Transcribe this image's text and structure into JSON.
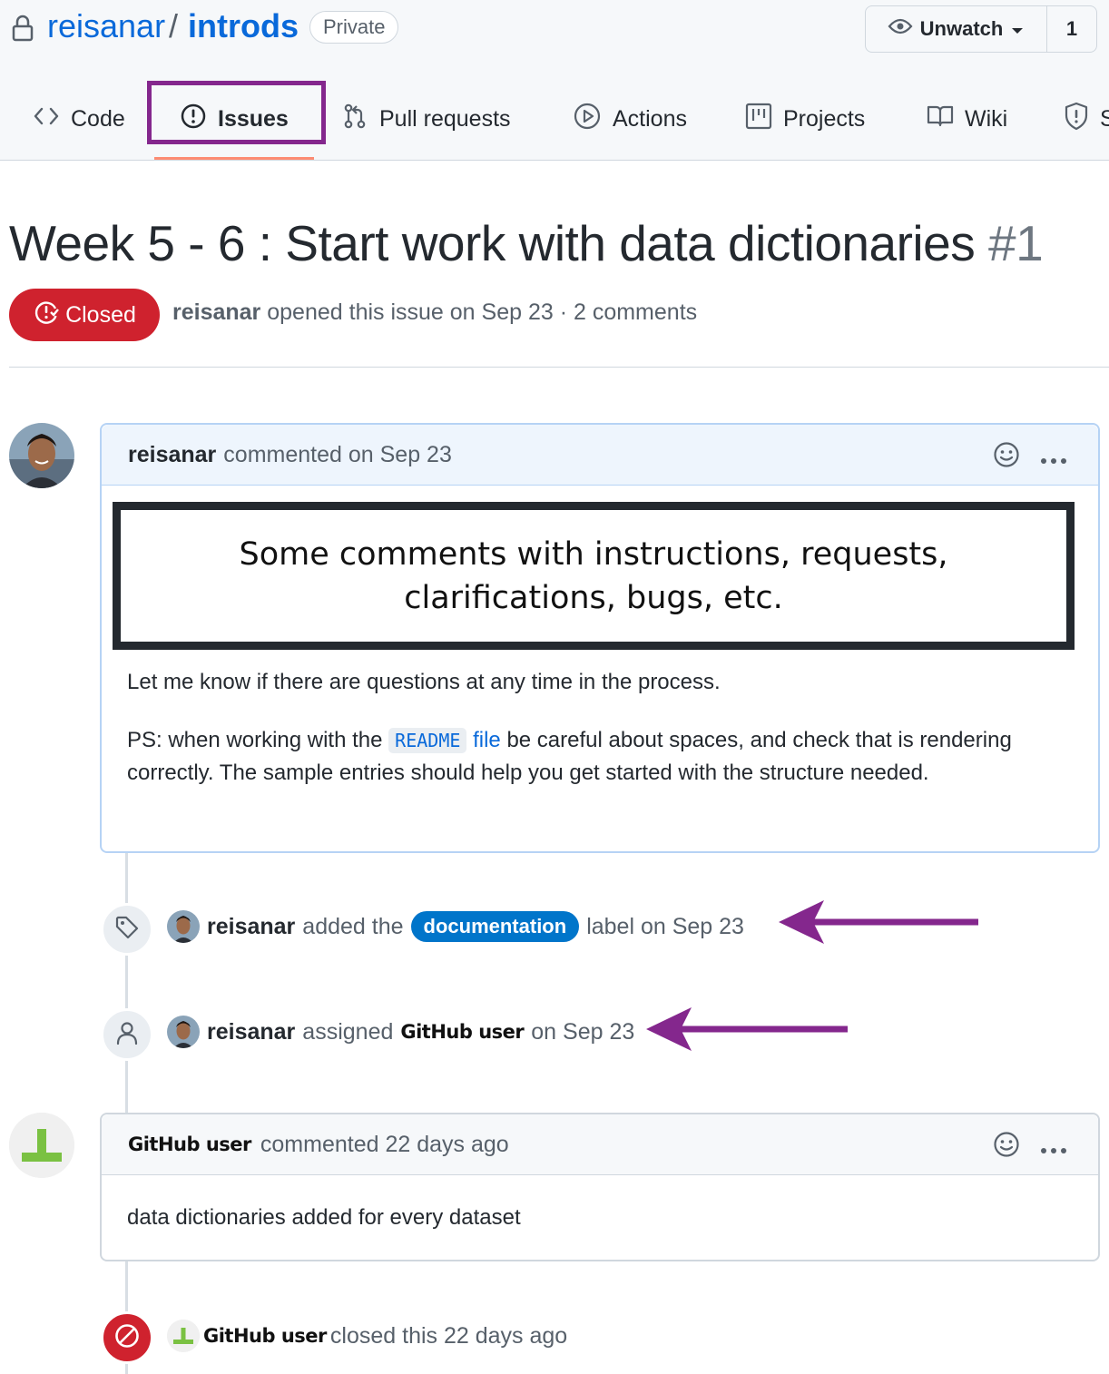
{
  "repo": {
    "owner": "reisanar",
    "separator": "/",
    "name": "introds",
    "visibility": "Private"
  },
  "watch": {
    "label": "Unwatch",
    "count": "1"
  },
  "tabs": [
    {
      "label": "Code"
    },
    {
      "label": "Issues"
    },
    {
      "label": "Pull requests"
    },
    {
      "label": "Actions"
    },
    {
      "label": "Projects"
    },
    {
      "label": "Wiki"
    },
    {
      "label": "S"
    }
  ],
  "issue": {
    "title": "Week 5 - 6 : Start work with data dictionaries",
    "number": "#1",
    "state": "Closed",
    "author": "reisanar",
    "meta_text": "opened this issue on Sep 23 · 2 comments"
  },
  "comments": [
    {
      "author": "reisanar",
      "action": "commented on Sep 23",
      "annotation_line1": "Some comments with instructions, requests,",
      "annotation_line2": "clarifications, bugs, etc.",
      "para1": "Let me know if there are questions at any time in the process.",
      "para2_before": "PS: when working with the",
      "para2_code": "README",
      "para2_link": "file",
      "para2_after": "be careful about spaces, and check that is rendering correctly. The sample entries should help you get started with the structure needed."
    },
    {
      "author": "GitHub user",
      "action": "commented 22 days ago",
      "body": "data dictionaries added for every dataset"
    }
  ],
  "events": [
    {
      "actor": "reisanar",
      "before": "added the",
      "label": "documentation",
      "after": "label on Sep 23"
    },
    {
      "actor": "reisanar",
      "before": "assigned",
      "target": "GitHub user",
      "after": "on Sep 23"
    },
    {
      "actor": "GitHub user",
      "text": "closed this 22 days ago"
    }
  ],
  "colors": {
    "accent_link": "#0969da",
    "closed_red": "#cf222e",
    "label_blue": "#0075ca",
    "highlight_purple": "#84278d",
    "annotation_arrow": "#84278d"
  }
}
